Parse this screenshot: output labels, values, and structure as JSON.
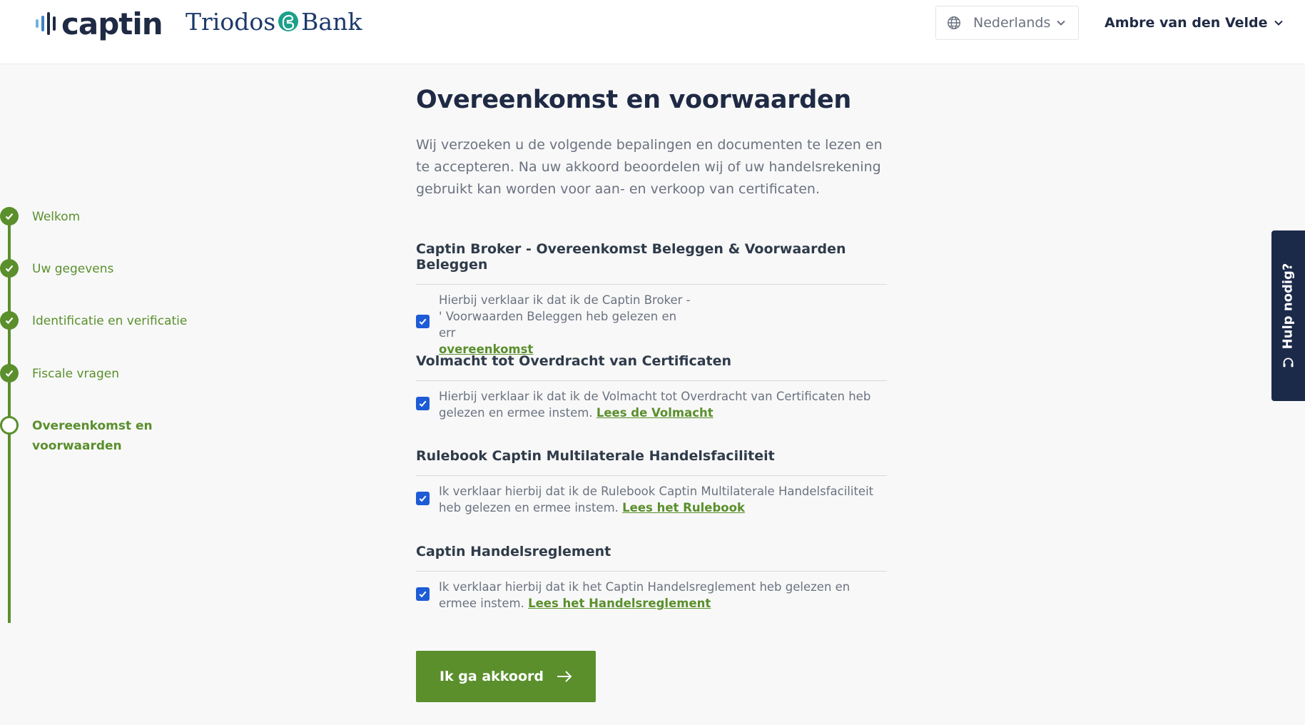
{
  "header": {
    "brand_captin": "captin",
    "brand_triodos_left": "Triodos",
    "brand_triodos_right": "Bank",
    "language": "Nederlands",
    "user": "Ambre van den Velde"
  },
  "stepper": {
    "steps": [
      {
        "label": "Welkom",
        "status": "done"
      },
      {
        "label": "Uw gegevens",
        "status": "done"
      },
      {
        "label": "Identificatie en verificatie",
        "status": "done"
      },
      {
        "label": "Fiscale vragen",
        "status": "done"
      },
      {
        "label": "Overeenkomst en voorwaarden",
        "status": "current"
      }
    ]
  },
  "page": {
    "title": "Overeenkomst en voorwaarden",
    "intro": "Wij verzoeken u de volgende bepalingen en documenten te lezen en te accepteren. Na uw akkoord beoordelen wij of uw handelsrekening gebruikt kan worden voor aan- en verkoop van certificaten."
  },
  "sections": [
    {
      "title": "Captin Broker - Overeenkomst Beleggen & Voorwaarden Beleggen",
      "text": "Hierbij verklaar ik dat ik de Captin Broker - ' Voorwaarden Beleggen heb gelezen en err",
      "link": "overeenkomst",
      "checked": true
    },
    {
      "title": "Volmacht tot Overdracht van Certificaten",
      "text": "Hierbij verklaar ik dat ik de Volmacht tot Overdracht van Certificaten heb gelezen en ermee instem.",
      "link": "Lees de Volmacht",
      "checked": true
    },
    {
      "title": "Rulebook Captin Multilaterale Handelsfaciliteit",
      "text": "Ik verklaar hierbij dat ik de Rulebook Captin Multilaterale Handelsfaciliteit heb gelezen en ermee instem.",
      "link": "Lees het Rulebook",
      "checked": true
    },
    {
      "title": "Captin Handelsreglement",
      "text": "Ik verklaar hierbij dat ik het Captin Handelsreglement heb gelezen en ermee instem.",
      "link": "Lees het Handelsreglement",
      "checked": true
    }
  ],
  "actions": {
    "accept": "Ik ga akkoord"
  },
  "help": {
    "label": "Hulp nodig?"
  },
  "colors": {
    "brand_green": "#5a8f2c",
    "navy": "#1f2a44",
    "checkbox_blue": "#1e5bd6",
    "help_tab": "#1c2a4a"
  },
  "icons": [
    "globe-icon",
    "chevron-down-icon",
    "check-icon",
    "arrow-right-icon",
    "headset-icon"
  ]
}
